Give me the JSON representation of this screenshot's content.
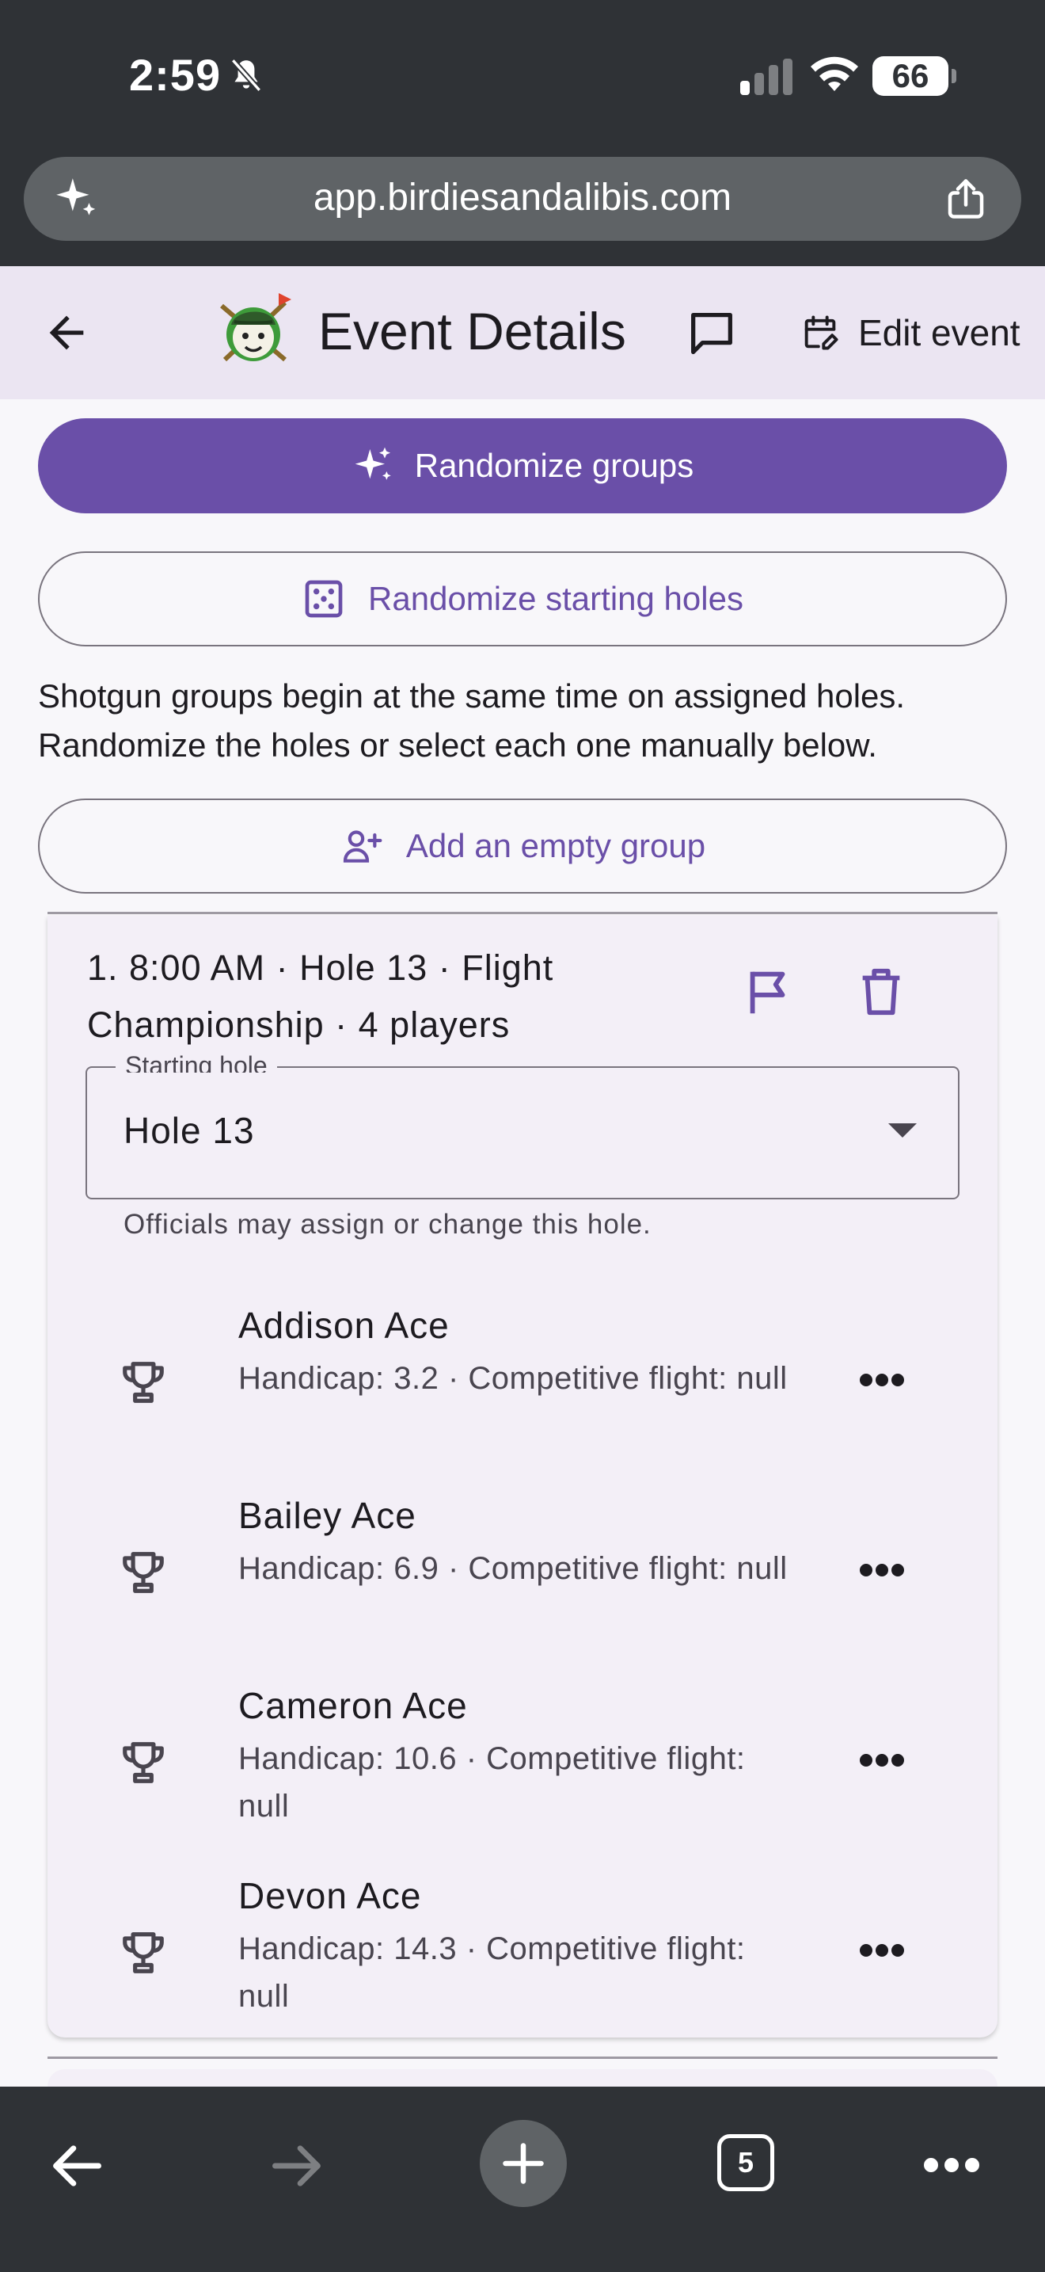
{
  "status_bar": {
    "time": "2:59",
    "battery": "66"
  },
  "browser": {
    "url": "app.birdiesandalibis.com",
    "tab_count": "5"
  },
  "appbar": {
    "title": "Event Details",
    "edit_label": "Edit event"
  },
  "actions": {
    "randomize_groups": "Randomize groups",
    "randomize_holes": "Randomize starting holes",
    "help_text": "Shotgun groups begin at the same time on assigned holes. Randomize the holes or select each one manually below.",
    "add_group": "Add an empty group"
  },
  "group": {
    "heading": "1. 8:00 AM · Hole 13 · Flight Championship · 4 players",
    "select_label": "Starting hole",
    "select_value": "Hole 13",
    "helper": "Officials may assign or change this hole.",
    "players": [
      {
        "name": "Addison Ace",
        "detail": "Handicap: 3.2 · Competitive flight: null"
      },
      {
        "name": "Bailey Ace",
        "detail": "Handicap: 6.9 · Competitive flight: null"
      },
      {
        "name": "Cameron Ace",
        "detail": "Handicap: 10.6 · Competitive flight: null"
      },
      {
        "name": "Devon Ace",
        "detail": "Handicap: 14.3 · Competitive flight: null"
      }
    ]
  },
  "colors": {
    "primary": "#6a4fa8",
    "appbar_bg": "#ebe5f2",
    "card_bg": "#f3eff7",
    "chrome_bg": "#2f3236"
  }
}
